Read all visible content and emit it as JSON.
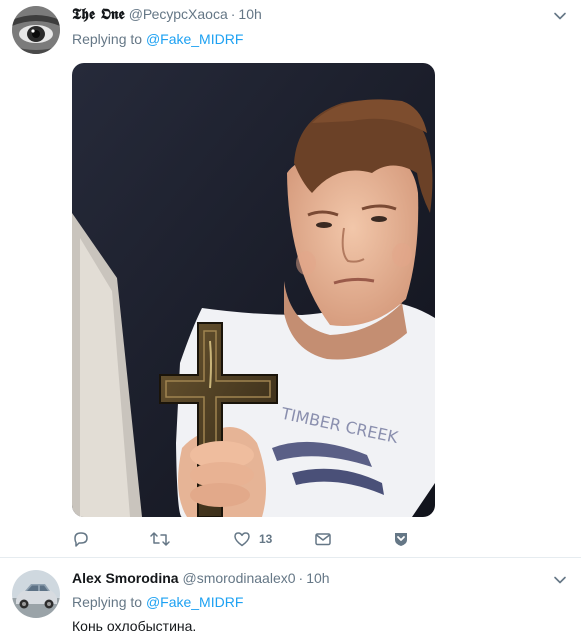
{
  "tweets": [
    {
      "name": "𝕿𝖍𝖊 𝕺𝖓𝖊",
      "handle": "@РесурсХаоса",
      "time": "10h",
      "replying_prefix": "Replying to",
      "replying_to": "@Fake_MIDRF",
      "media": "photo",
      "actions": {
        "reply_count": "",
        "retweet_count": "",
        "like_count": "13"
      }
    },
    {
      "name": "Alex Smorodina",
      "handle": "@smorodinaalex0",
      "time": "10h",
      "replying_prefix": "Replying to",
      "replying_to": "@Fake_MIDRF",
      "text": "Конь охлобыстина."
    }
  ],
  "colors": {
    "accent": "#1da1f2",
    "muted": "#657786",
    "text": "#14171a",
    "divider": "#e6ecf0"
  }
}
